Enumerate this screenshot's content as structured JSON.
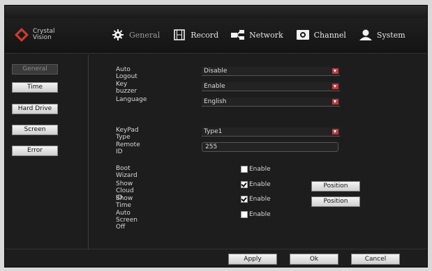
{
  "logo": {
    "line1": "Crystal",
    "line2": "Vision"
  },
  "tabs": [
    {
      "label": "General",
      "icon": "gear-icon",
      "active": true
    },
    {
      "label": "Record",
      "icon": "film-icon",
      "active": false
    },
    {
      "label": "Network",
      "icon": "network-icon",
      "active": false
    },
    {
      "label": "Channel",
      "icon": "camera-icon",
      "active": false
    },
    {
      "label": "System",
      "icon": "user-icon",
      "active": false
    }
  ],
  "sidebar": {
    "items": [
      {
        "label": "General",
        "active": true
      },
      {
        "label": "Time",
        "active": false
      },
      {
        "label": "Hard Drive",
        "active": false
      },
      {
        "label": "Screen",
        "active": false
      },
      {
        "label": "Error",
        "active": false
      }
    ]
  },
  "form": {
    "auto_logout": {
      "label": "Auto Logout",
      "value": "Disable"
    },
    "key_buzzer": {
      "label": "Key buzzer",
      "value": "Enable"
    },
    "language": {
      "label": "Language",
      "value": "English"
    },
    "keypad_type": {
      "label": "KeyPad Type",
      "value": "Type1"
    },
    "remote_id": {
      "label": "Remote ID",
      "value": "255"
    },
    "boot_wizard": {
      "label": "Boot Wizard",
      "check_label": "Enable",
      "checked": false
    },
    "show_cloud_id": {
      "label": "Show Cloud ID",
      "check_label": "Enable",
      "checked": true,
      "button": "Position"
    },
    "show_time": {
      "label": "Show Time",
      "check_label": "Enable",
      "checked": true,
      "button": "Position"
    },
    "auto_screen_off": {
      "label": "Auto Screen Off",
      "check_label": "Enable",
      "checked": false
    }
  },
  "footer": {
    "apply": "Apply",
    "ok": "Ok",
    "cancel": "Cancel"
  },
  "colors": {
    "accent_red": "#c23b3b",
    "logo_red": "#d03a30",
    "background": "#1d1d1d"
  }
}
